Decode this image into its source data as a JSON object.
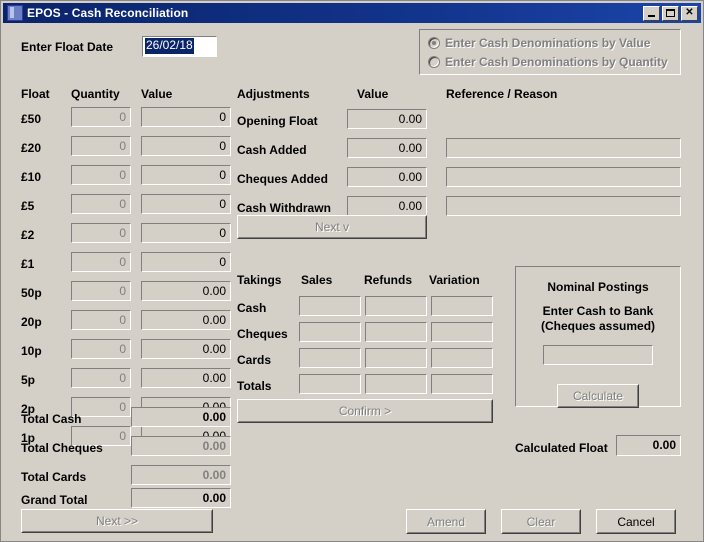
{
  "window": {
    "title": "EPOS -  Cash Reconciliation",
    "icon": "window-icon",
    "minimize": "minimize-icon",
    "maximize": "maximize-icon",
    "close": "✕"
  },
  "float_date": {
    "label": "Enter Float Date",
    "value": "26/02/18"
  },
  "denomination_mode": {
    "options": [
      {
        "label": "Enter Cash Denominations by Value",
        "selected": true
      },
      {
        "label": "Enter Cash Denominations by Quantity",
        "selected": false
      }
    ]
  },
  "float": {
    "headers": [
      "Float",
      "Quantity",
      "Value"
    ],
    "rows": [
      {
        "denomination": "£50",
        "quantity": "0",
        "value": "0"
      },
      {
        "denomination": "£20",
        "quantity": "0",
        "value": "0"
      },
      {
        "denomination": "£10",
        "quantity": "0",
        "value": "0"
      },
      {
        "denomination": "£5",
        "quantity": "0",
        "value": "0"
      },
      {
        "denomination": "£2",
        "quantity": "0",
        "value": "0"
      },
      {
        "denomination": "£1",
        "quantity": "0",
        "value": "0"
      },
      {
        "denomination": "50p",
        "quantity": "0",
        "value": "0.00"
      },
      {
        "denomination": "20p",
        "quantity": "0",
        "value": "0.00"
      },
      {
        "denomination": "10p",
        "quantity": "0",
        "value": "0.00"
      },
      {
        "denomination": "5p",
        "quantity": "0",
        "value": "0.00"
      },
      {
        "denomination": "2p",
        "quantity": "0",
        "value": "0.00"
      },
      {
        "denomination": "1p",
        "quantity": "0",
        "value": "0.00"
      }
    ]
  },
  "totals": {
    "rows": [
      {
        "label": "Total Cash",
        "value": "0.00",
        "dim": false
      },
      {
        "label": "Total Cheques",
        "value": "0.00",
        "dim": true
      },
      {
        "label": "Total Cards",
        "value": "0.00",
        "dim": true
      },
      {
        "label": "Grand Total",
        "value": "0.00",
        "dim": false
      }
    ],
    "next_button": "Next >>"
  },
  "adjustments": {
    "headers": [
      "Adjustments",
      "Value",
      "Reference / Reason"
    ],
    "rows": [
      {
        "label": "Opening Float",
        "value": "0.00",
        "reference": ""
      },
      {
        "label": "Cash Added",
        "value": "0.00",
        "reference": ""
      },
      {
        "label": "Cheques Added",
        "value": "0.00",
        "reference": ""
      },
      {
        "label": "Cash Withdrawn",
        "value": "0.00",
        "reference": ""
      }
    ],
    "next_button": "Next  v"
  },
  "takings": {
    "headers": [
      "Takings",
      "Sales",
      "Refunds",
      "Variation"
    ],
    "rows": [
      {
        "label": "Cash",
        "sales": "",
        "refunds": "",
        "variation": ""
      },
      {
        "label": "Cheques",
        "sales": "",
        "refunds": "",
        "variation": ""
      },
      {
        "label": "Cards",
        "sales": "",
        "refunds": "",
        "variation": ""
      },
      {
        "label": "Totals",
        "sales": "",
        "refunds": "",
        "variation": ""
      }
    ],
    "confirm_button": "Confirm >"
  },
  "nominal_postings": {
    "title": "Nominal Postings",
    "subtitle_line1": "Enter Cash to Bank",
    "subtitle_line2": "(Cheques assumed)",
    "cash_to_bank_value": "",
    "calculate_button": "Calculate"
  },
  "calculated_float": {
    "label": "Calculated Float",
    "value": "0.00"
  },
  "actions": {
    "amend": "Amend",
    "clear": "Clear",
    "cancel": "Cancel"
  },
  "colors": {
    "face": "#d4d0c8",
    "title_start": "#0a246a",
    "title_end": "#1c44a8",
    "disabled_text": "#808080",
    "selection": "#0a246a"
  }
}
